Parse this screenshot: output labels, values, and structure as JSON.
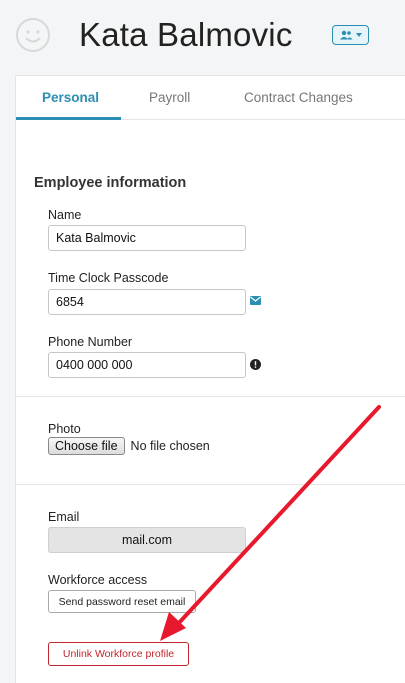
{
  "header": {
    "title": "Kata Balmovic",
    "avatar_icon": "smiley-face-icon",
    "role_button_icon": "people-icon"
  },
  "tabs": [
    {
      "label": "Personal",
      "active": true
    },
    {
      "label": "Payroll",
      "active": false
    },
    {
      "label": "Contract Changes",
      "active": false
    }
  ],
  "form": {
    "section_heading": "Employee information",
    "name": {
      "label": "Name",
      "value": "Kata Balmovic"
    },
    "passcode": {
      "label": "Time Clock Passcode",
      "value": "6854",
      "icon": "envelope-icon"
    },
    "phone": {
      "label": "Phone Number",
      "value": "0400 000 000",
      "icon": "exclamation-circle-icon"
    },
    "photo": {
      "label": "Photo",
      "button": "Choose file",
      "status": "No file chosen"
    },
    "email": {
      "label": "Email",
      "value": "mail.com"
    },
    "workforce": {
      "label": "Workforce access",
      "reset_button": "Send password reset email"
    },
    "unlink_button": "Unlink Workforce profile"
  },
  "colors": {
    "accent": "#2b8fb3",
    "danger": "#c0252d",
    "annotation_arrow": "#e8192c"
  }
}
